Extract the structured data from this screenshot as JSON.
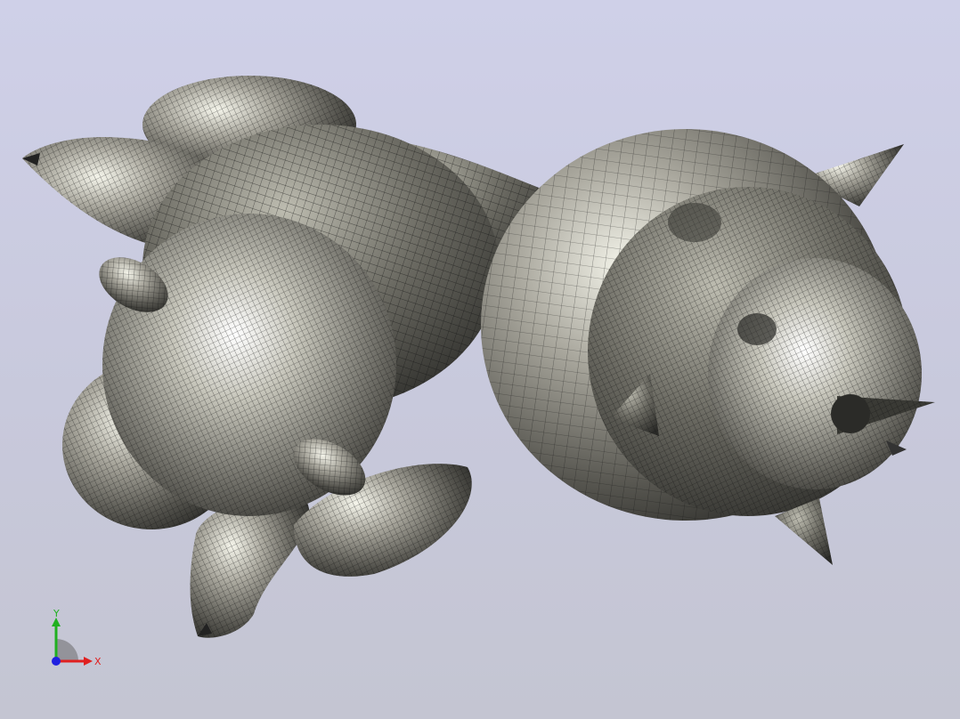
{
  "viewer": {
    "background_top": "#cfd0e8",
    "background_bottom": "#c4c5d2",
    "model": {
      "display_mode": "shaded-with-mesh-edges",
      "surface_color": "#8c8a80",
      "mesh_edge_color": "#000000"
    },
    "triad": {
      "x_label": "X",
      "y_label": "Y",
      "x_color": "#e02020",
      "y_color": "#20b020",
      "z_color": "#2020e0"
    }
  }
}
